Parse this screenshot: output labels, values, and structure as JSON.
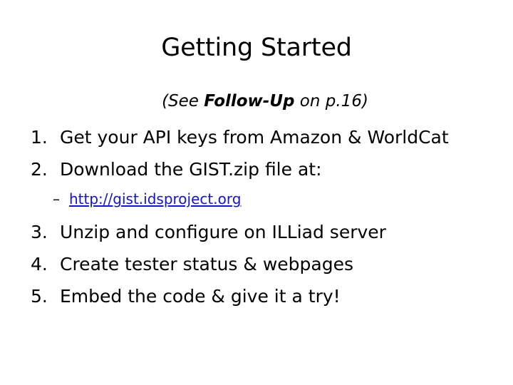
{
  "slide": {
    "title": "Getting Started",
    "subtitle": {
      "prefix": "(See ",
      "emphasis": "Follow-Up",
      "suffix": " on p.16)"
    },
    "steps": [
      {
        "marker": "1.",
        "text": "Get your API keys from Amazon & WorldCat"
      },
      {
        "marker": "2.",
        "text": "Download the GIST.zip file at:"
      },
      {
        "marker": "3.",
        "text": "Unzip and configure on ILLiad server"
      },
      {
        "marker": "4.",
        "text": "Create tester status & webpages"
      },
      {
        "marker": "5.",
        "text": "Embed the code & give it a try!"
      }
    ],
    "sub_bullet": {
      "dash": "–",
      "link_text": "http://gist.idsproject.org"
    },
    "colors": {
      "background": "#ffffff",
      "text": "#000000",
      "link": "#1414CC"
    }
  }
}
